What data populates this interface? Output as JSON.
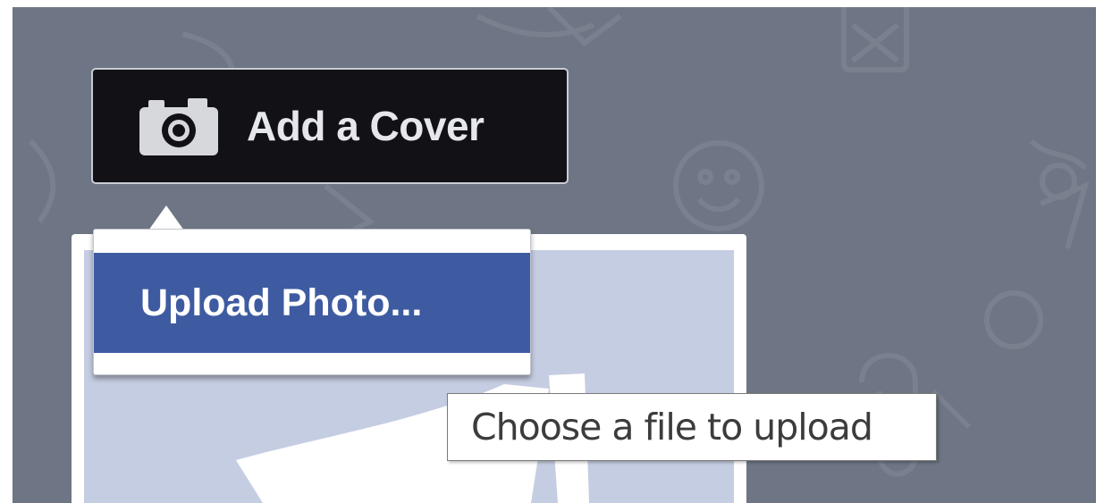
{
  "cover": {
    "add_cover_label": "Add a Cover",
    "camera_icon": "camera-icon"
  },
  "menu": {
    "items": [
      {
        "label": "Upload Photo..."
      }
    ]
  },
  "tooltip": {
    "text": "Choose a file to upload"
  },
  "colors": {
    "cover_background": "#6e7584",
    "button_background": "#121216",
    "menu_highlight": "#3e5ba1",
    "profile_placeholder": "#c5cde2"
  }
}
